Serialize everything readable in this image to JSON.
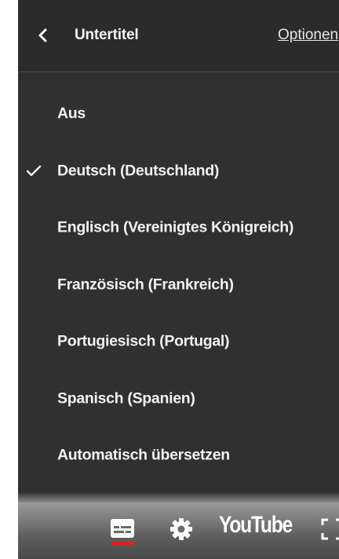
{
  "header": {
    "back_icon": "chevron-left-icon",
    "title": "Untertitel",
    "options_label": "Optionen"
  },
  "subtitle_menu": {
    "selected": "Deutsch (Deutschland)",
    "items": [
      {
        "label": "Aus",
        "checked": false
      },
      {
        "label": "Deutsch (Deutschland)",
        "checked": true
      },
      {
        "label": "Englisch (Vereinigtes Königreich)",
        "checked": false
      },
      {
        "label": "Französisch (Frankreich)",
        "checked": false
      },
      {
        "label": "Portugiesisch (Portugal)",
        "checked": false
      },
      {
        "label": "Spanisch (Spanien)",
        "checked": false
      },
      {
        "label": "Automatisch übersetzen",
        "checked": false
      }
    ]
  },
  "control_bar": {
    "captions_icon": "subtitles-icon",
    "captions_active": true,
    "settings_icon": "gear-icon",
    "logo_text": "YouTube",
    "fullscreen_icon": "fullscreen-icon"
  },
  "colors": {
    "menu_background": "#303030",
    "text": "#f1f1f1",
    "active_underline": "#e0201c"
  }
}
